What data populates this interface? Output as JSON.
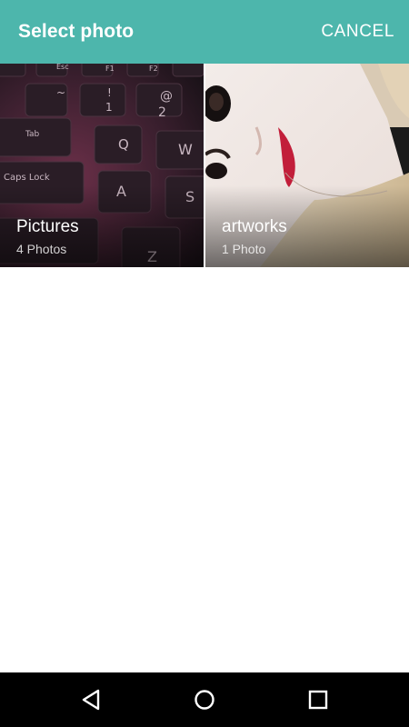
{
  "app_bar": {
    "title": "Select photo",
    "cancel_label": "CANCEL",
    "background": "#4db6ac"
  },
  "albums": [
    {
      "name": "Pictures",
      "count": "4 Photos",
      "thumbnail_icon": "keyboard-photo"
    },
    {
      "name": "artworks",
      "count": "1 Photo",
      "thumbnail_icon": "portrait-photo"
    }
  ],
  "nav_bar": {
    "icons": [
      "back-icon",
      "home-icon",
      "recent-apps-icon"
    ],
    "background": "#000000"
  }
}
